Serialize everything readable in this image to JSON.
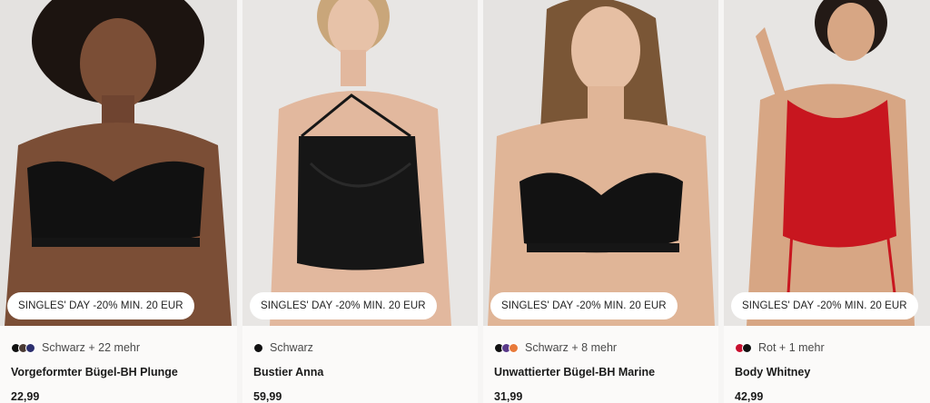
{
  "products": [
    {
      "badge": "SINGLES' DAY -20% MIN. 20 EUR",
      "colors_text": "Schwarz + 22 mehr",
      "swatches": [
        "#111111",
        "#4a3a33",
        "#2c2f6e"
      ],
      "name": "Vorgeformter Bügel-BH Plunge",
      "price": "22,99"
    },
    {
      "badge": "SINGLES' DAY -20% MIN. 20 EUR",
      "colors_text": "Schwarz",
      "swatches": [
        "#111111"
      ],
      "name": "Bustier Anna",
      "price": "59,99"
    },
    {
      "badge": "SINGLES' DAY -20% MIN. 20 EUR",
      "colors_text": "Schwarz + 8 mehr",
      "swatches": [
        "#111111",
        "#5a3a8a",
        "#e87a3a"
      ],
      "name": "Unwattierter Bügel-BH Marine",
      "price": "31,99"
    },
    {
      "badge": "SINGLES' DAY -20% MIN. 20 EUR",
      "colors_text": "Rot + 1 mehr",
      "swatches": [
        "#c8102e",
        "#111111"
      ],
      "name": "Body Whitney",
      "price": "42,99"
    }
  ]
}
